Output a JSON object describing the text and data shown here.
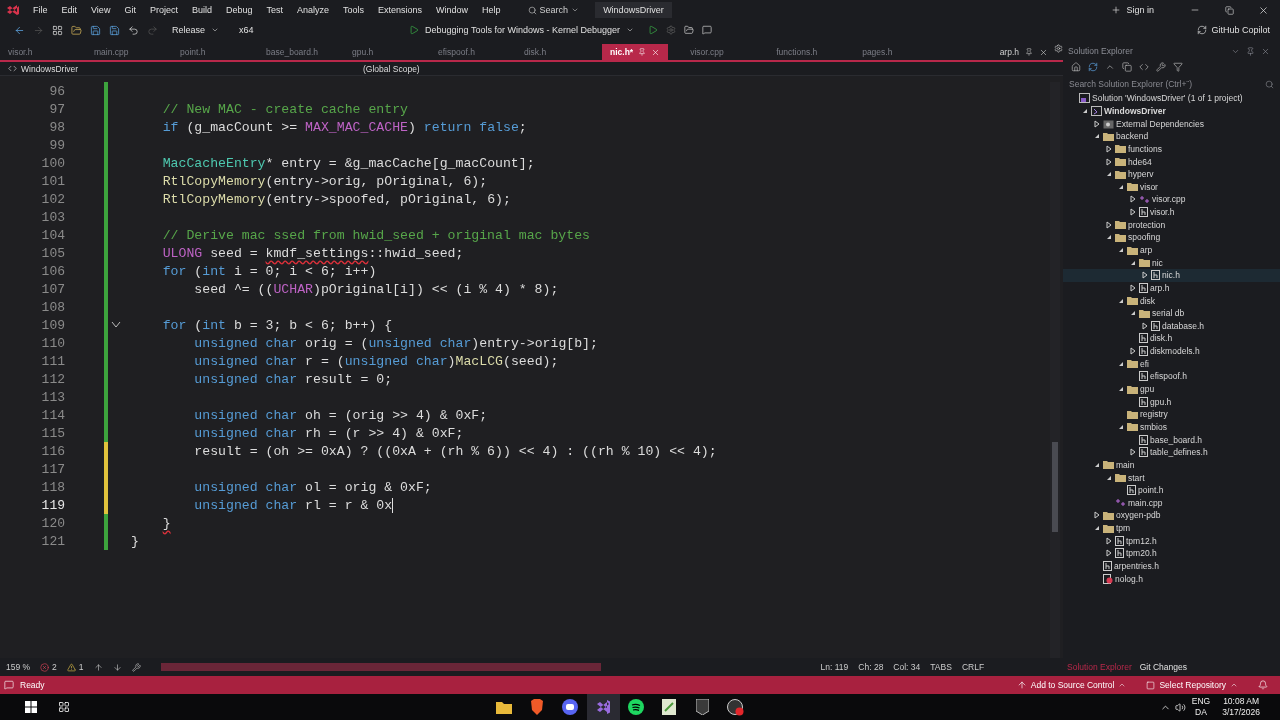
{
  "title_bar": {
    "menu": [
      "File",
      "Edit",
      "View",
      "Git",
      "Project",
      "Build",
      "Debug",
      "Test",
      "Analyze",
      "Tools",
      "Extensions",
      "Window",
      "Help"
    ],
    "search": "Search",
    "solution_name": "WindowsDriver",
    "sign_in": "Sign in"
  },
  "toolbar": {
    "configuration": "Release",
    "platform": "x64",
    "debug_target": "Debugging Tools for Windows - Kernel Debugger",
    "copilot": "GitHub Copilot"
  },
  "tabs": [
    {
      "label": "visor.h",
      "selected": false
    },
    {
      "label": "main.cpp",
      "selected": false
    },
    {
      "label": "point.h",
      "selected": false
    },
    {
      "label": "base_board.h",
      "selected": false
    },
    {
      "label": "gpu.h",
      "selected": false
    },
    {
      "label": "efispoof.h",
      "selected": false
    },
    {
      "label": "disk.h",
      "selected": false
    },
    {
      "label": "nic.h*",
      "selected": true
    },
    {
      "label": "visor.cpp",
      "selected": false
    },
    {
      "label": "functions.h",
      "selected": false
    },
    {
      "label": "pages.h",
      "selected": false
    }
  ],
  "pinned_tab": {
    "label": "arp.h"
  },
  "nav_bar": {
    "project": "WindowsDriver",
    "scope": "(Global Scope)"
  },
  "editor": {
    "lines": [
      {
        "number": "96",
        "unsaved": false
      },
      {
        "number": "97",
        "unsaved": false,
        "segments": [
          {
            "kind": "comment",
            "text": "    // New MAC - create cache entry"
          }
        ]
      },
      {
        "number": "98",
        "unsaved": false,
        "segments": [
          {
            "kind": "keyword",
            "text": "    if"
          },
          {
            "kind": "plain",
            "text": " (g_macCount >= "
          },
          {
            "kind": "macro",
            "text": "MAX_MAC_CACHE"
          },
          {
            "kind": "plain",
            "text": ") "
          },
          {
            "kind": "keyword",
            "text": "return false"
          },
          {
            "kind": "plain",
            "text": ";"
          }
        ]
      },
      {
        "number": "99",
        "unsaved": false
      },
      {
        "number": "100",
        "unsaved": false,
        "segments": [
          {
            "kind": "type",
            "text": "    MacCacheEntry"
          },
          {
            "kind": "plain",
            "text": "* entry = &g_macCache[g_macCount];"
          }
        ]
      },
      {
        "number": "101",
        "unsaved": false,
        "segments": [
          {
            "kind": "function",
            "text": "    RtlCopyMemory"
          },
          {
            "kind": "plain",
            "text": "(entry->orig, pOriginal, 6);"
          }
        ]
      },
      {
        "number": "102",
        "unsaved": false,
        "segments": [
          {
            "kind": "function",
            "text": "    RtlCopyMemory"
          },
          {
            "kind": "plain",
            "text": "(entry->spoofed, pOriginal, 6);"
          }
        ]
      },
      {
        "number": "103",
        "unsaved": false
      },
      {
        "number": "104",
        "unsaved": false,
        "segments": [
          {
            "kind": "comment",
            "text": "    // Derive mac ssed from hwid_seed + original mac bytes"
          }
        ]
      },
      {
        "number": "105",
        "unsaved": false,
        "segments": [
          {
            "kind": "macro",
            "text": "    ULONG"
          },
          {
            "kind": "plain",
            "text": " seed = "
          },
          {
            "kind": "error",
            "text": "kmdf_settings"
          },
          {
            "kind": "plain",
            "text": "::hwid_seed;"
          }
        ]
      },
      {
        "number": "106",
        "unsaved": false,
        "segments": [
          {
            "kind": "keyword",
            "text": "    for"
          },
          {
            "kind": "plain",
            "text": " ("
          },
          {
            "kind": "keyword",
            "text": "int"
          },
          {
            "kind": "plain",
            "text": " i = 0; i < 6; i++)"
          }
        ]
      },
      {
        "number": "107",
        "unsaved": false,
        "segments": [
          {
            "kind": "plain",
            "text": "        seed ^= (("
          },
          {
            "kind": "macro",
            "text": "UCHAR"
          },
          {
            "kind": "plain",
            "text": ")pOriginal[i]) << (i % 4) * 8);"
          }
        ]
      },
      {
        "number": "108",
        "unsaved": false
      },
      {
        "number": "109",
        "unsaved": false,
        "fold_marker": true,
        "segments": [
          {
            "kind": "keyword",
            "text": "    for"
          },
          {
            "kind": "plain",
            "text": " ("
          },
          {
            "kind": "keyword",
            "text": "int"
          },
          {
            "kind": "plain",
            "text": " b = 3; b < 6; b++) {"
          }
        ]
      },
      {
        "number": "110",
        "unsaved": false,
        "segments": [
          {
            "kind": "keyword",
            "text": "        unsigned char"
          },
          {
            "kind": "plain",
            "text": " orig = ("
          },
          {
            "kind": "keyword",
            "text": "unsigned char"
          },
          {
            "kind": "plain",
            "text": ")entry->orig[b];"
          }
        ]
      },
      {
        "number": "111",
        "unsaved": false,
        "segments": [
          {
            "kind": "keyword",
            "text": "        unsigned char"
          },
          {
            "kind": "plain",
            "text": " r = ("
          },
          {
            "kind": "keyword",
            "text": "unsigned char"
          },
          {
            "kind": "plain",
            "text": ")"
          },
          {
            "kind": "function",
            "text": "MacLCG"
          },
          {
            "kind": "plain",
            "text": "(seed);"
          }
        ]
      },
      {
        "number": "112",
        "unsaved": false,
        "segments": [
          {
            "kind": "keyword",
            "text": "        unsigned char"
          },
          {
            "kind": "plain",
            "text": " result = 0;"
          }
        ]
      },
      {
        "number": "113",
        "unsaved": false
      },
      {
        "number": "114",
        "unsaved": false,
        "segments": [
          {
            "kind": "keyword",
            "text": "        unsigned char"
          },
          {
            "kind": "plain",
            "text": " oh = (orig >> 4) & 0xF;"
          }
        ]
      },
      {
        "number": "115",
        "unsaved": false,
        "segments": [
          {
            "kind": "keyword",
            "text": "        unsigned char"
          },
          {
            "kind": "plain",
            "text": " rh = (r >> 4) & 0xF;"
          }
        ]
      },
      {
        "number": "116",
        "unsaved": true,
        "segments": [
          {
            "kind": "plain",
            "text": "        result = (oh >= 0xA) ? ((0xA + (rh % 6)) << 4) : ((rh % 10) << 4);"
          }
        ]
      },
      {
        "number": "117",
        "unsaved": true
      },
      {
        "number": "118",
        "unsaved": true,
        "segments": [
          {
            "kind": "keyword",
            "text": "        unsigned char"
          },
          {
            "kind": "plain",
            "text": " ol = orig & 0xF;"
          }
        ]
      },
      {
        "number": "119",
        "unsaved": true,
        "cursor": true,
        "segments": [
          {
            "kind": "keyword",
            "text": "        unsigned char"
          },
          {
            "kind": "plain",
            "text": " rl = r & 0x"
          }
        ]
      },
      {
        "number": "120",
        "unsaved": false,
        "segments": [
          {
            "kind": "error",
            "text": "    }"
          }
        ]
      },
      {
        "number": "121",
        "unsaved": false,
        "segments": [
          {
            "kind": "plain",
            "text": "}"
          }
        ]
      }
    ]
  },
  "solution_explorer": {
    "title": "Solution Explorer",
    "search_placeholder": "Search Solution Explorer (Ctrl+¨)",
    "tree": [
      {
        "label": "Solution 'WindowsDriver' (1 of 1 project)",
        "kind": "solution",
        "selected": false,
        "children": [
          {
            "label": "WindowsDriver",
            "kind": "project",
            "expanded": true,
            "selected": false,
            "children": [
              {
                "label": "External Dependencies",
                "kind": "dependencies",
                "expanded": false,
                "selected": false
              },
              {
                "label": "backend",
                "kind": "folder",
                "expanded": true,
                "selected": false,
                "children": [
                  {
                    "label": "functions",
                    "kind": "folder",
                    "expanded": false,
                    "selected": false
                  },
                  {
                    "label": "hde64",
                    "kind": "folder",
                    "expanded": false,
                    "selected": false
                  },
                  {
                    "label": "hyperv",
                    "kind": "folder",
                    "expanded": true,
                    "selected": false,
                    "children": [
                      {
                        "label": "visor",
                        "kind": "folder",
                        "expanded": true,
                        "selected": false,
                        "children": [
                          {
                            "label": "visor.cpp",
                            "kind": "source",
                            "expanded": false,
                            "selected": false
                          },
                          {
                            "label": "visor.h",
                            "kind": "header",
                            "expanded": false,
                            "selected": false
                          }
                        ]
                      }
                    ]
                  },
                  {
                    "label": "protection",
                    "kind": "folder",
                    "expanded": false,
                    "selected": false
                  },
                  {
                    "label": "spoofing",
                    "kind": "folder",
                    "expanded": true,
                    "selected": false,
                    "children": [
                      {
                        "label": "arp",
                        "kind": "folder",
                        "expanded": true,
                        "selected": false,
                        "children": [
                          {
                            "label": "nic",
                            "kind": "folder",
                            "expanded": true,
                            "selected": false,
                            "children": [
                              {
                                "label": "nic.h",
                                "kind": "header",
                                "expanded": false,
                                "selected": true
                              }
                            ]
                          },
                          {
                            "label": "arp.h",
                            "kind": "header",
                            "expanded": false,
                            "selected": false
                          }
                        ]
                      },
                      {
                        "label": "disk",
                        "kind": "folder",
                        "expanded": true,
                        "selected": false,
                        "children": [
                          {
                            "label": "serial db",
                            "kind": "folder",
                            "expanded": true,
                            "selected": false,
                            "children": [
                              {
                                "label": "database.h",
                                "kind": "header",
                                "expanded": false,
                                "selected": false
                              }
                            ]
                          },
                          {
                            "label": "disk.h",
                            "kind": "header",
                            "selected": false
                          },
                          {
                            "label": "diskmodels.h",
                            "kind": "header",
                            "expanded": false,
                            "selected": false
                          }
                        ]
                      },
                      {
                        "label": "efi",
                        "kind": "folder",
                        "expanded": true,
                        "selected": false,
                        "children": [
                          {
                            "label": "efispoof.h",
                            "kind": "header",
                            "selected": false
                          }
                        ]
                      },
                      {
                        "label": "gpu",
                        "kind": "folder",
                        "expanded": true,
                        "selected": false,
                        "children": [
                          {
                            "label": "gpu.h",
                            "kind": "header",
                            "selected": false
                          }
                        ]
                      },
                      {
                        "label": "registry",
                        "kind": "folder",
                        "selected": false
                      },
                      {
                        "label": "smbios",
                        "kind": "folder",
                        "expanded": true,
                        "selected": false,
                        "children": [
                          {
                            "label": "base_board.h",
                            "kind": "header",
                            "selected": false
                          },
                          {
                            "label": "table_defines.h",
                            "kind": "header",
                            "expanded": false,
                            "selected": false
                          }
                        ]
                      }
                    ]
                  }
                ]
              },
              {
                "label": "main",
                "kind": "folder",
                "expanded": true,
                "selected": false,
                "children": [
                  {
                    "label": "start",
                    "kind": "folder",
                    "expanded": true,
                    "selected": false,
                    "children": [
                      {
                        "label": "point.h",
                        "kind": "header",
                        "selected": false
                      }
                    ]
                  },
                  {
                    "label": "main.cpp",
                    "kind": "source",
                    "selected": false
                  }
                ]
              },
              {
                "label": "oxygen-pdb",
                "kind": "folder",
                "expanded": false,
                "selected": false
              },
              {
                "label": "tpm",
                "kind": "folder",
                "expanded": true,
                "selected": false,
                "children": [
                  {
                    "label": "tpm12.h",
                    "kind": "header",
                    "expanded": false,
                    "selected": false
                  },
                  {
                    "label": "tpm20.h",
                    "kind": "header",
                    "expanded": false,
                    "selected": false
                  }
                ]
              },
              {
                "label": "arpentries.h",
                "kind": "header",
                "selected": false
              },
              {
                "label": "nolog.h",
                "kind": "excluded",
                "selected": false
              }
            ]
          }
        ]
      }
    ]
  },
  "editor_status": {
    "zoom": "159 %",
    "errors": "2",
    "warnings": "1",
    "line": "Ln: 119",
    "char": "Ch: 28",
    "col": "Col: 34",
    "indent": "TABS",
    "line_ending": "CRLF"
  },
  "tool_tabs": [
    {
      "label": "Solution Explorer",
      "selected": true
    },
    {
      "label": "Git Changes",
      "selected": false
    }
  ],
  "status_bar": {
    "message": "Ready",
    "source_control": "Add to Source Control",
    "repository": "Select Repository"
  },
  "taskbar": {
    "language": "ENG",
    "layout": "DA",
    "time": "10:08 AM",
    "date": "3/17/2026"
  }
}
